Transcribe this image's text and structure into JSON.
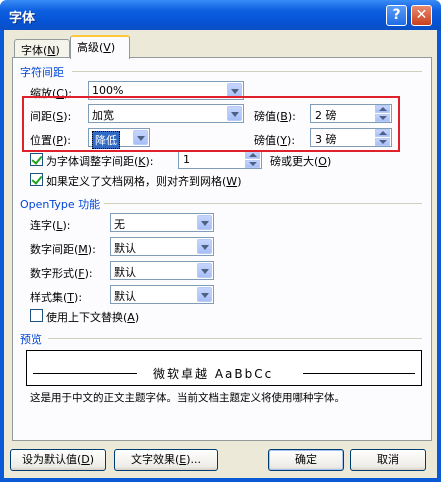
{
  "window": {
    "title": "字体",
    "help_symbol": "?",
    "close_symbol": "✕"
  },
  "tabs": [
    {
      "label": "字体",
      "key": "N"
    },
    {
      "label": "高级",
      "key": "V"
    }
  ],
  "char_spacing": {
    "group_label": "字符间距",
    "scale": {
      "label": "缩放",
      "key": "C",
      "value": "100%"
    },
    "spacing": {
      "label": "间距",
      "key": "S",
      "value": "加宽",
      "by_label": "磅值",
      "by_key": "B",
      "by_value": "2 磅"
    },
    "position": {
      "label": "位置",
      "key": "P",
      "value": "降低",
      "by_label": "磅值",
      "by_key": "Y",
      "by_value": "3 磅"
    },
    "kerning": {
      "label": "为字体调整字间距",
      "key": "K",
      "value": "1",
      "suffix": "磅或更大",
      "suffix_key": "O",
      "checked": true
    },
    "snap_grid": {
      "label": "如果定义了文档网格，则对齐到网格",
      "key": "W",
      "checked": true
    }
  },
  "opentype": {
    "group_label": "OpenType 功能",
    "ligatures": {
      "label": "连字",
      "key": "L",
      "value": "无"
    },
    "number_spacing": {
      "label": "数字间距",
      "key": "M",
      "value": "默认"
    },
    "number_forms": {
      "label": "数字形式",
      "key": "F",
      "value": "默认"
    },
    "stylistic_sets": {
      "label": "样式集",
      "key": "T",
      "value": "默认"
    },
    "contextual_alternates": {
      "label": "使用上下文替换",
      "key": "A",
      "checked": false
    }
  },
  "preview": {
    "group_label": "预览",
    "sample_text": "微软卓越  AaBbCc",
    "description": "这是用于中文的正文主题字体。当前文档主题定义将使用哪种字体。"
  },
  "buttons": {
    "set_default": {
      "label": "设为默认值",
      "key": "D"
    },
    "text_effects": {
      "label": "文字效果",
      "key": "E",
      "ellipsis": "..."
    },
    "ok": "确定",
    "cancel": "取消"
  },
  "colors": {
    "title_bar": "#0653d6",
    "group_label": "#0046d5",
    "highlight_box": "#e0202a",
    "selection": "#316ac5"
  }
}
